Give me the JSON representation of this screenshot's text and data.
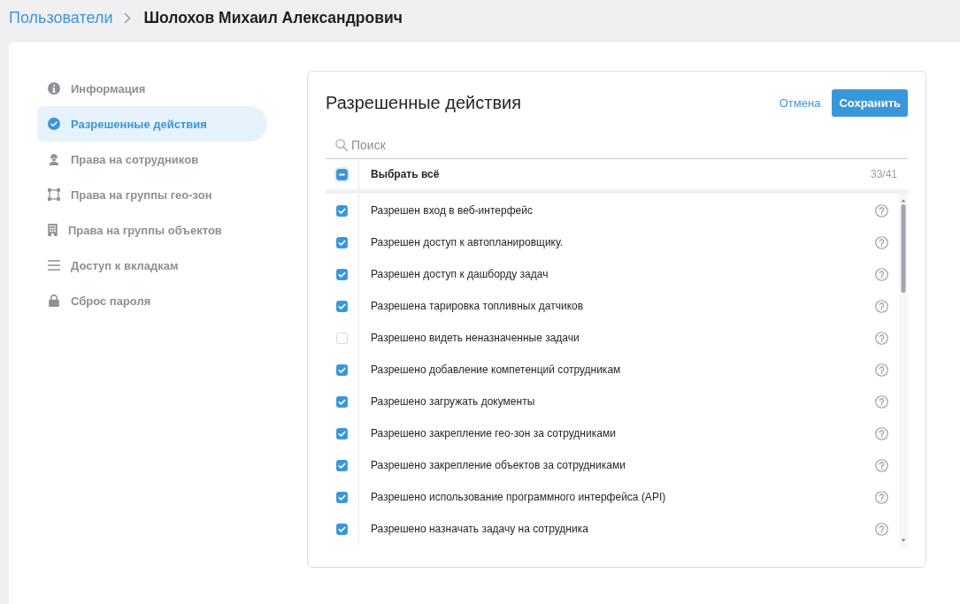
{
  "breadcrumb": {
    "parent": "Пользователи",
    "current": "Шолохов Михаил Александрович"
  },
  "sidebar": {
    "items": [
      {
        "label": "Информация",
        "selected": false
      },
      {
        "label": "Разрешенные действия",
        "selected": true
      },
      {
        "label": "Права на сотрудников",
        "selected": false
      },
      {
        "label": "Права на группы гео-зон",
        "selected": false
      },
      {
        "label": "Права на группы объектов",
        "selected": false
      },
      {
        "label": "Доступ к вкладкам",
        "selected": false
      },
      {
        "label": "Сброс пароля",
        "selected": false
      }
    ]
  },
  "panel": {
    "title": "Разрешенные действия",
    "cancel_button": "Отмена",
    "save_button": "Сохранить",
    "search": {
      "placeholder": "Поиск"
    },
    "select_all": {
      "label": "Выбрать всё",
      "indeterminate": true,
      "count": "33/41"
    },
    "permissions": [
      {
        "label": "Разрешен вход в веб-интерфейс",
        "checked": true
      },
      {
        "label": "Разрешен доступ к автопланировщику.",
        "checked": true
      },
      {
        "label": "Разрешен доступ к дашборду задач",
        "checked": true
      },
      {
        "label": "Разрешена тарировка топливных датчиков",
        "checked": true
      },
      {
        "label": "Разрешено видеть неназначенные задачи",
        "checked": false
      },
      {
        "label": "Разрешено добавление компетенций сотрудникам",
        "checked": true
      },
      {
        "label": "Разрешено загружать документы",
        "checked": true
      },
      {
        "label": "Разрешено закрепление гео-зон за сотрудниками",
        "checked": true
      },
      {
        "label": "Разрешено закрепление объектов за сотрудниками",
        "checked": true
      },
      {
        "label": "Разрешено использование программного интерфейса (API)",
        "checked": true
      },
      {
        "label": "Разрешено назначать задачу на сотрудника",
        "checked": true
      }
    ]
  }
}
